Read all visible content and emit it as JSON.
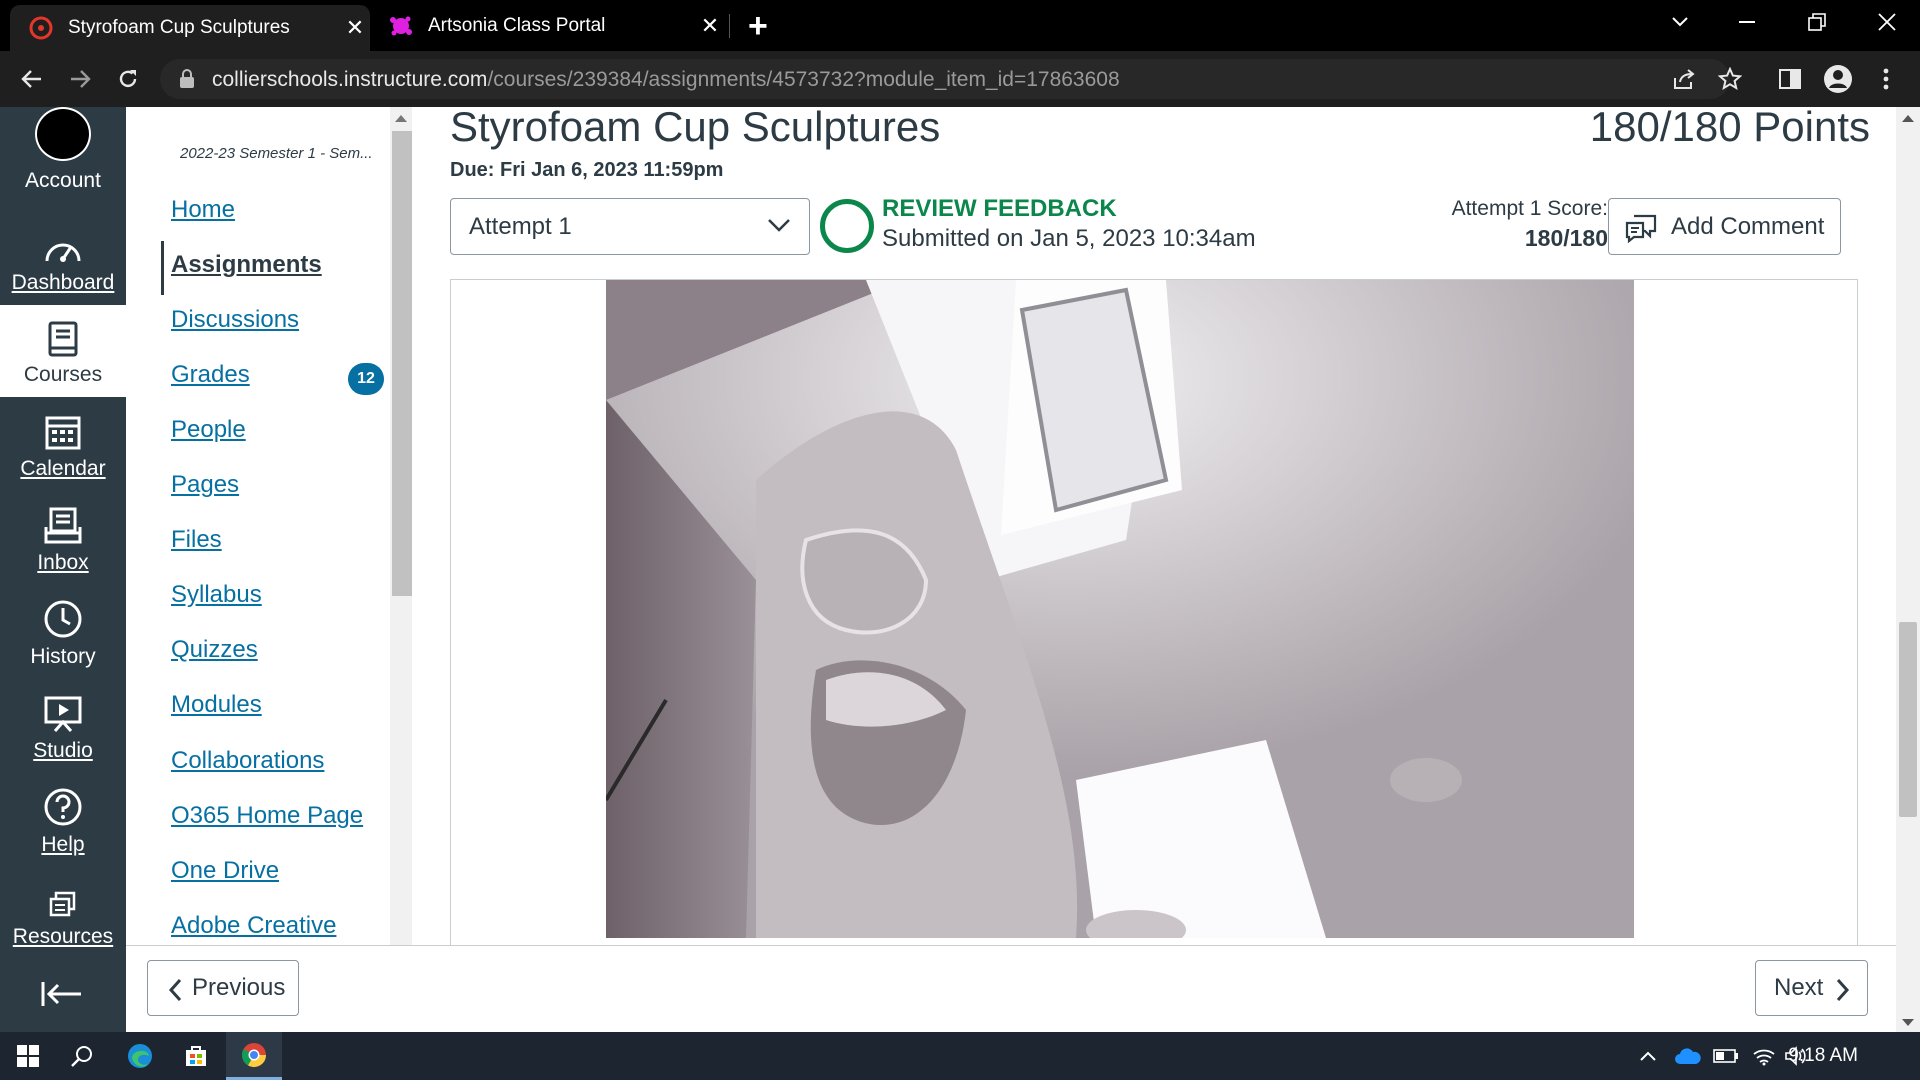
{
  "browser": {
    "tabs": [
      {
        "title": "Styrofoam Cup Sculptures",
        "active": true
      },
      {
        "title": "Artsonia Class Portal",
        "active": false
      }
    ],
    "url_host": "collierschools.instructure.com",
    "url_path": "/courses/239384/assignments/4573732?module_item_id=17863608"
  },
  "global_nav": {
    "account": "Account",
    "dashboard": "Dashboard",
    "courses": "Courses",
    "calendar": "Calendar",
    "inbox": "Inbox",
    "history": "History",
    "studio": "Studio",
    "help": "Help",
    "resources": "Resources"
  },
  "course_nav": {
    "term": "2022-23 Semester 1 - Sem...",
    "items": [
      "Home",
      "Assignments",
      "Discussions",
      "Grades",
      "People",
      "Pages",
      "Files",
      "Syllabus",
      "Quizzes",
      "Modules",
      "Collaborations",
      "O365 Home Page",
      "One Drive",
      "Adobe Creative"
    ],
    "active": "Assignments",
    "grades_badge": "12"
  },
  "assignment": {
    "title": "Styrofoam Cup Sculptures",
    "points": "180/180",
    "points_label": "Points",
    "due": "Due: Fri Jan 6, 2023 11:59pm",
    "attempt_selected": "Attempt 1",
    "feedback_title": "REVIEW FEEDBACK",
    "submitted": "Submitted on Jan 5, 2023 10:34am",
    "score_label": "Attempt 1 Score:",
    "score_value": "180/180",
    "add_comment": "Add Comment"
  },
  "footer": {
    "previous": "Previous",
    "next": "Next"
  },
  "taskbar": {
    "time": "9:18 AM"
  },
  "colors": {
    "canvas_nav": "#2d3b45",
    "link": "#0770a3",
    "success": "#0b874b"
  }
}
